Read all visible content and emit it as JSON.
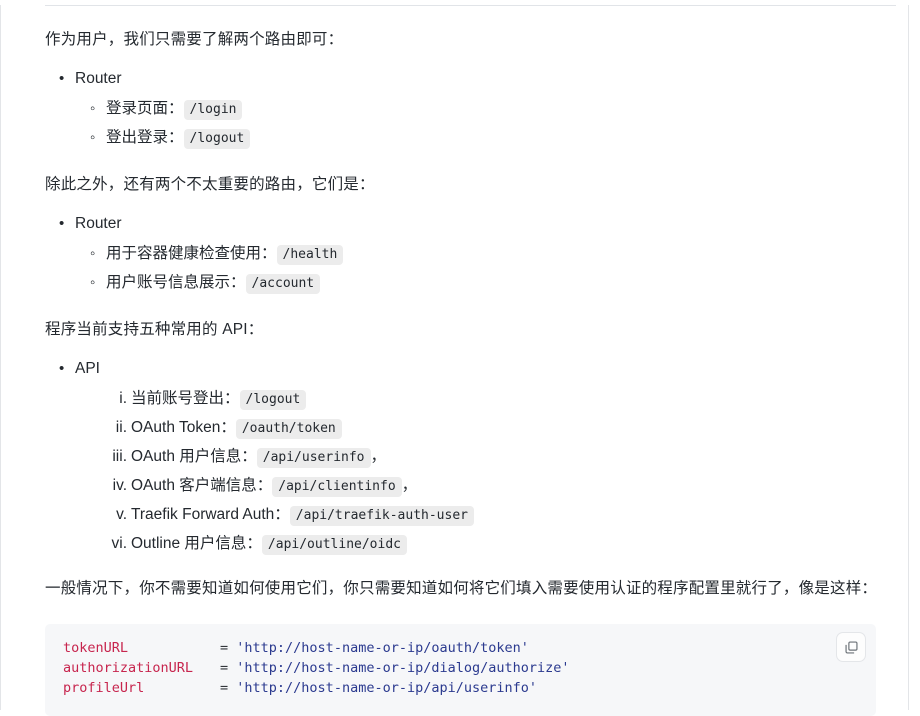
{
  "document": {
    "paragraphs": {
      "intro_routes": "作为用户，我们只需要了解两个路由即可：",
      "minor_routes": "除此之外，还有两个不太重要的路由，它们是：",
      "apis_intro": "程序当前支持五种常用的 API：",
      "usage_note": "一般情况下，你不需要知道如何使用它们，你只需要知道如何将它们填入需要使用认证的程序配置里就行了，像是这样："
    },
    "list_router_main": {
      "title": "Router",
      "items": [
        {
          "label": "登录页面：",
          "code": "/login",
          "suffix": ""
        },
        {
          "label": "登出登录：",
          "code": "/logout",
          "suffix": ""
        }
      ]
    },
    "list_router_minor": {
      "title": "Router",
      "items": [
        {
          "label": "用于容器健康检查使用：",
          "code": "/health",
          "suffix": ""
        },
        {
          "label": "用户账号信息展示：",
          "code": "/account",
          "suffix": ""
        }
      ]
    },
    "list_api": {
      "title": "API",
      "items": [
        {
          "marker": "i.",
          "label": "当前账号登出：",
          "code": "/logout",
          "suffix": ""
        },
        {
          "marker": "ii.",
          "label": "OAuth Token：",
          "code": "/oauth/token",
          "suffix": ""
        },
        {
          "marker": "iii.",
          "label": "OAuth 用户信息：",
          "code": "/api/userinfo",
          "suffix": "，"
        },
        {
          "marker": "iv.",
          "label": "OAuth 客户端信息：",
          "code": "/api/clientinfo",
          "suffix": "，"
        },
        {
          "marker": "v.",
          "label": "Traefik Forward Auth：",
          "code": "/api/traefik-auth-user",
          "suffix": ""
        },
        {
          "marker": "vi.",
          "label": "Outline 用户信息：",
          "code": "/api/outline/oidc",
          "suffix": ""
        }
      ]
    },
    "code_block": {
      "copy_label": "复制",
      "lines": [
        {
          "key": "tokenURL",
          "op": "=",
          "value": "'http://host-name-or-ip/oauth/token'"
        },
        {
          "key": "authorizationURL",
          "op": "=",
          "value": "'http://host-name-or-ip/dialog/authorize'"
        },
        {
          "key": "profileUrl",
          "op": "=",
          "value": "'http://host-name-or-ip/api/userinfo'"
        }
      ]
    },
    "colors": {
      "text": "#24292f",
      "inline_code_bg": "#ececec",
      "code_block_bg": "#f6f7f9",
      "code_key": "#c7254e",
      "code_string": "#2b3a8f",
      "rule": "#e1e4e8"
    }
  }
}
